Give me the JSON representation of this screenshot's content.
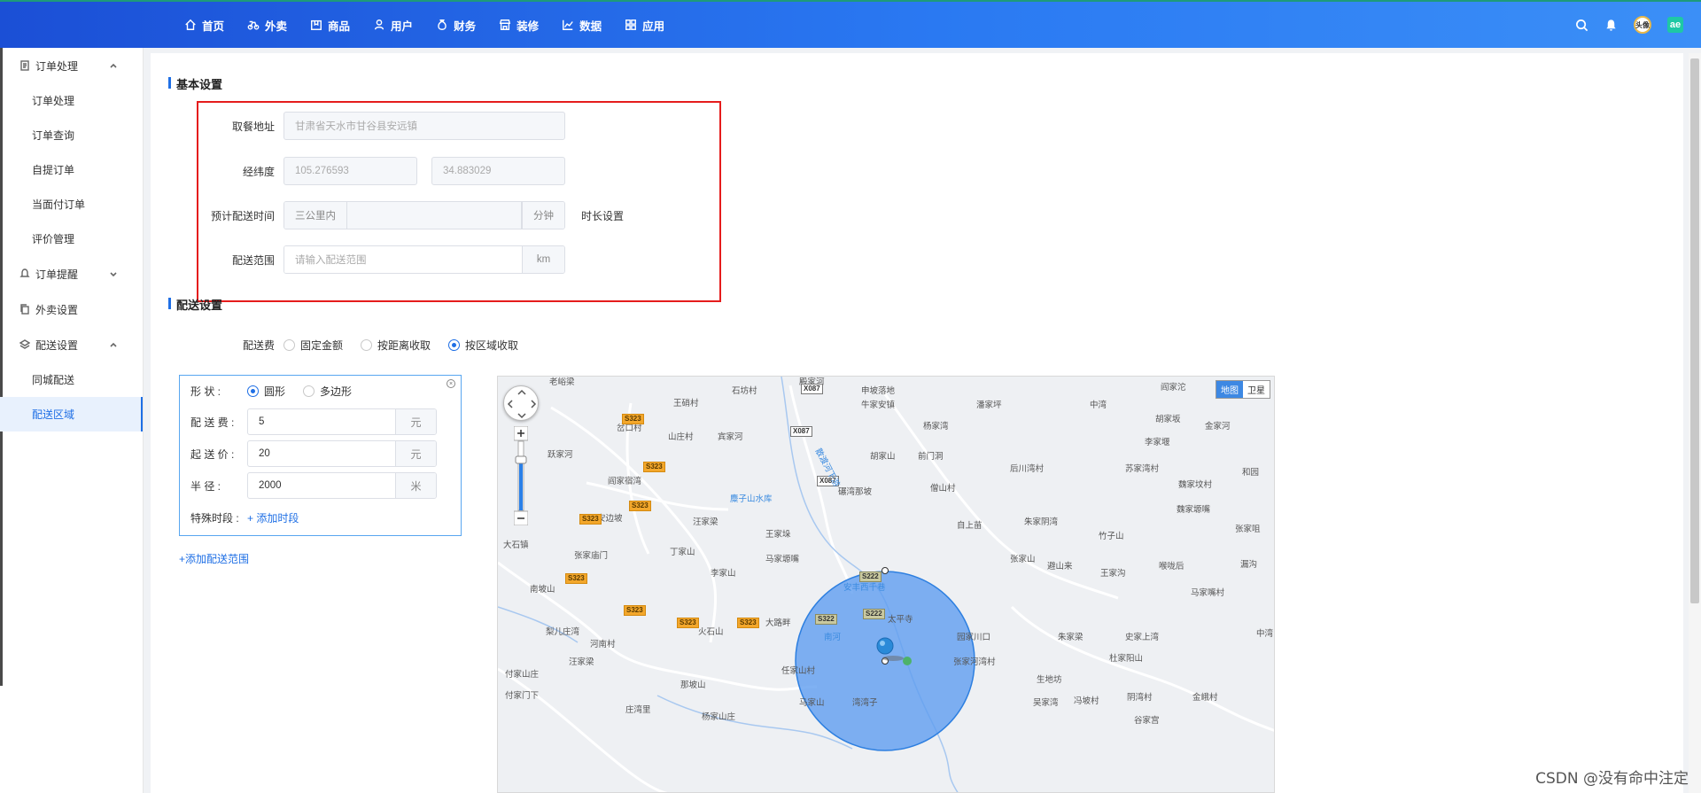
{
  "topnav": {
    "items": [
      {
        "label": "首页",
        "icon": "home-icon"
      },
      {
        "label": "外卖",
        "icon": "bike-icon"
      },
      {
        "label": "商品",
        "icon": "box-icon"
      },
      {
        "label": "用户",
        "icon": "user-icon"
      },
      {
        "label": "财务",
        "icon": "money-bag-icon"
      },
      {
        "label": "装修",
        "icon": "shop-icon"
      },
      {
        "label": "数据",
        "icon": "chart-icon"
      },
      {
        "label": "应用",
        "icon": "grid-icon"
      }
    ],
    "avatar_text": "头像",
    "brand_text": "ae"
  },
  "sidebar": {
    "groups": [
      {
        "label": "订单处理",
        "items": [
          "订单处理",
          "订单查询",
          "自提订单",
          "当面付订单",
          "评价管理"
        ]
      },
      {
        "label": "订单提醒"
      },
      {
        "label": "外卖设置"
      },
      {
        "label": "配送设置",
        "items": [
          "同城配送",
          "配送区域"
        ]
      }
    ],
    "active_item": "配送区域"
  },
  "basic": {
    "title": "基本设置",
    "pickup_label": "取餐地址",
    "pickup_value": "甘肃省天水市甘谷县安远镇",
    "coord_label": "经纬度",
    "lng": "105.276593",
    "lat": "34.883029",
    "eta_label": "预计配送时间",
    "eta_prefix": "三公里内",
    "eta_unit": "分钟",
    "eta_link": "时长设置",
    "range_label": "配送范围",
    "range_placeholder": "请输入配送范围",
    "range_unit": "km"
  },
  "delivery": {
    "title": "配送设置",
    "fee_label": "配送费",
    "fee_options": [
      "固定金额",
      "按距离收取",
      "按区域收取"
    ],
    "fee_selected": "按区域收取"
  },
  "zone": {
    "shape_label": "形 状 :",
    "shape_options": [
      "圆形",
      "多边形"
    ],
    "shape_selected": "圆形",
    "fee_label": "配 送 费 :",
    "fee_value": "5",
    "fee_unit": "元",
    "min_label": "起 送 价 :",
    "min_value": "20",
    "min_unit": "元",
    "radius_label": "半 径 :",
    "radius_value": "2000",
    "radius_unit": "米",
    "special_label": "特殊时段 :",
    "special_add": "+ 添加时段",
    "add_zone": "+添加配送范围"
  },
  "map": {
    "type_map": "地图",
    "type_sat": "卫星",
    "places": [
      {
        "t": "老峪梁",
        "c": "#555"
      },
      {
        "t": "王硝村"
      },
      {
        "t": "石坊村"
      },
      {
        "t": "殿家河"
      },
      {
        "t": "申坡落地"
      },
      {
        "t": "潘家坪"
      },
      {
        "t": "阎家沱"
      },
      {
        "t": "岔口村"
      },
      {
        "t": "山庄村"
      },
      {
        "t": "宾家河"
      },
      {
        "t": "牛家安镇"
      },
      {
        "t": "杨家湾"
      },
      {
        "t": "中湾"
      },
      {
        "t": "胡家坂"
      },
      {
        "t": "金家河"
      },
      {
        "t": "跃家河"
      },
      {
        "t": "胡家山"
      },
      {
        "t": "前门洞"
      },
      {
        "t": "后川湾村"
      },
      {
        "t": "苏家湾村"
      },
      {
        "t": "李家堰"
      },
      {
        "t": "阎家宿湾"
      },
      {
        "t": "麋子山水库",
        "blue": true
      },
      {
        "t": "碾湾那坡"
      },
      {
        "t": "僧山村"
      },
      {
        "t": "魏家坟村"
      },
      {
        "t": "和园"
      },
      {
        "t": "安边坡"
      },
      {
        "t": "汪家梁"
      },
      {
        "t": "自上苗"
      },
      {
        "t": "朱家阴湾"
      },
      {
        "t": "魏家塬嘴"
      },
      {
        "t": "张家咀"
      },
      {
        "t": "大石镇"
      },
      {
        "t": "丁家山"
      },
      {
        "t": "王家垛"
      },
      {
        "t": "竹子山"
      },
      {
        "t": "张家庙门"
      },
      {
        "t": "马家塬嘴"
      },
      {
        "t": "张家山"
      },
      {
        "t": "避山来"
      },
      {
        "t": "王家沟"
      },
      {
        "t": "喉咙后"
      },
      {
        "t": "漏沟"
      },
      {
        "t": "南坡山"
      },
      {
        "t": "李家山"
      },
      {
        "t": "马家嘴村"
      },
      {
        "t": "安丰西千巷",
        "blue": true
      },
      {
        "t": "大路畔"
      },
      {
        "t": "火石山"
      },
      {
        "t": "太平寺"
      },
      {
        "t": "梨儿庄湾"
      },
      {
        "t": "南河",
        "blue": true
      },
      {
        "t": "园家川口"
      },
      {
        "t": "朱家梁"
      },
      {
        "t": "史家上湾"
      },
      {
        "t": "中湾"
      },
      {
        "t": "河南村"
      },
      {
        "t": "张家河湾村"
      },
      {
        "t": "杜家阳山"
      },
      {
        "t": "汪家梁"
      },
      {
        "t": "付家山庄"
      },
      {
        "t": "任家山村"
      },
      {
        "t": "生地坊"
      },
      {
        "t": "那坡山"
      },
      {
        "t": "付家门下"
      },
      {
        "t": "马家山"
      },
      {
        "t": "湾湾子"
      },
      {
        "t": "吴家湾"
      },
      {
        "t": "冯坡村"
      },
      {
        "t": "阴湾村"
      },
      {
        "t": "金峨村"
      },
      {
        "t": "庄湾里"
      },
      {
        "t": "杨家山庄"
      },
      {
        "t": "谷家宫"
      }
    ],
    "roads": [
      "X087",
      "X087",
      "X087",
      "S323",
      "S323",
      "S323",
      "S323",
      "S323",
      "S323",
      "S323",
      "S323",
      "S222",
      "S222",
      "S322"
    ],
    "river_label": "散渡河下游"
  },
  "watermark": "CSDN @没有命中注定"
}
